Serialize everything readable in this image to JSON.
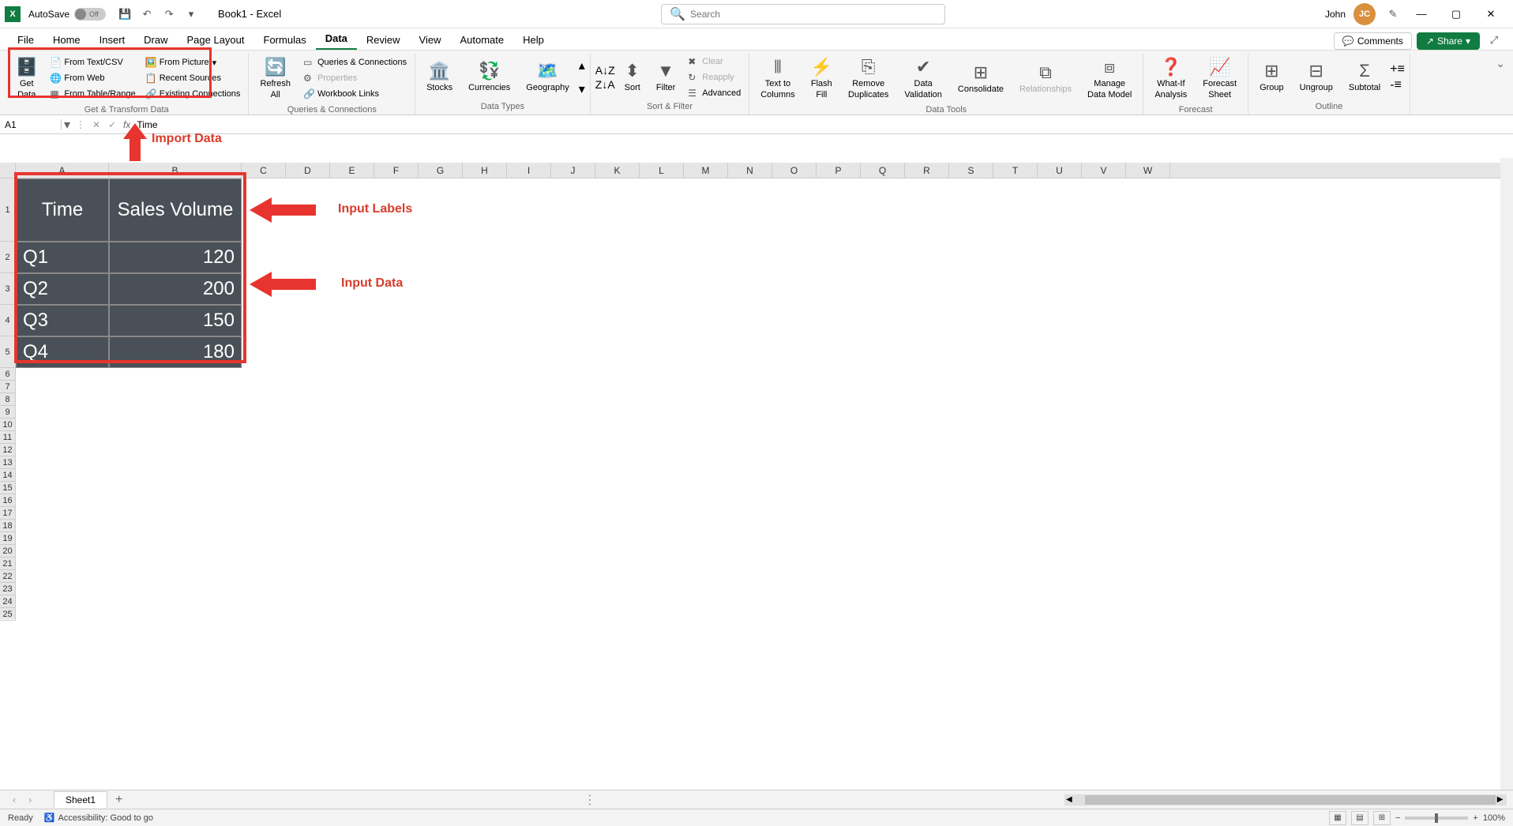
{
  "titlebar": {
    "autosave_label": "AutoSave",
    "autosave_state": "Off",
    "doc_title": "Book1 - Excel",
    "search_placeholder": "Search",
    "user_name": "John",
    "user_initials": "JC"
  },
  "tabs": {
    "file": "File",
    "home": "Home",
    "insert": "Insert",
    "draw": "Draw",
    "page_layout": "Page Layout",
    "formulas": "Formulas",
    "data": "Data",
    "review": "Review",
    "view": "View",
    "automate": "Automate",
    "help": "Help",
    "comments": "Comments",
    "share": "Share"
  },
  "ribbon": {
    "get_data": "Get\nData",
    "from_text_csv": "From Text/CSV",
    "from_web": "From Web",
    "from_table_range": "From Table/Range",
    "from_picture": "From Picture",
    "recent_sources": "Recent Sources",
    "existing_connections": "Existing Connections",
    "group_transform": "Get & Transform Data",
    "refresh_all": "Refresh\nAll",
    "queries_connections": "Queries & Connections",
    "properties": "Properties",
    "workbook_links": "Workbook Links",
    "group_queries": "Queries & Connections",
    "stocks": "Stocks",
    "currencies": "Currencies",
    "geography": "Geography",
    "group_datatypes": "Data Types",
    "sort": "Sort",
    "filter": "Filter",
    "clear": "Clear",
    "reapply": "Reapply",
    "advanced": "Advanced",
    "group_sortfilter": "Sort & Filter",
    "text_to_columns": "Text to\nColumns",
    "flash_fill": "Flash\nFill",
    "remove_duplicates": "Remove\nDuplicates",
    "data_validation": "Data\nValidation",
    "consolidate": "Consolidate",
    "relationships": "Relationships",
    "manage_data_model": "Manage\nData Model",
    "group_datatools": "Data Tools",
    "what_if": "What-If\nAnalysis",
    "forecast_sheet": "Forecast\nSheet",
    "group_forecast": "Forecast",
    "group": "Group",
    "ungroup": "Ungroup",
    "subtotal": "Subtotal",
    "group_outline": "Outline"
  },
  "formula_bar": {
    "name_box": "A1",
    "formula_value": "Time"
  },
  "annotations": {
    "import_data": "Import Data",
    "input_labels": "Input Labels",
    "input_data": "Input Data"
  },
  "columns": [
    "A",
    "B",
    "C",
    "D",
    "E",
    "F",
    "G",
    "H",
    "I",
    "J",
    "K",
    "L",
    "M",
    "N",
    "O",
    "P",
    "Q",
    "R",
    "S",
    "T",
    "U",
    "V",
    "W"
  ],
  "data_table": {
    "headers": {
      "a": "Time",
      "b": "Sales Volume"
    },
    "rows": [
      {
        "a": "Q1",
        "b": "120"
      },
      {
        "a": "Q2",
        "b": "200"
      },
      {
        "a": "Q3",
        "b": "150"
      },
      {
        "a": "Q4",
        "b": "180"
      }
    ]
  },
  "sheet": {
    "name": "Sheet1"
  },
  "status": {
    "ready": "Ready",
    "accessibility": "Accessibility: Good to go",
    "zoom": "100%"
  }
}
